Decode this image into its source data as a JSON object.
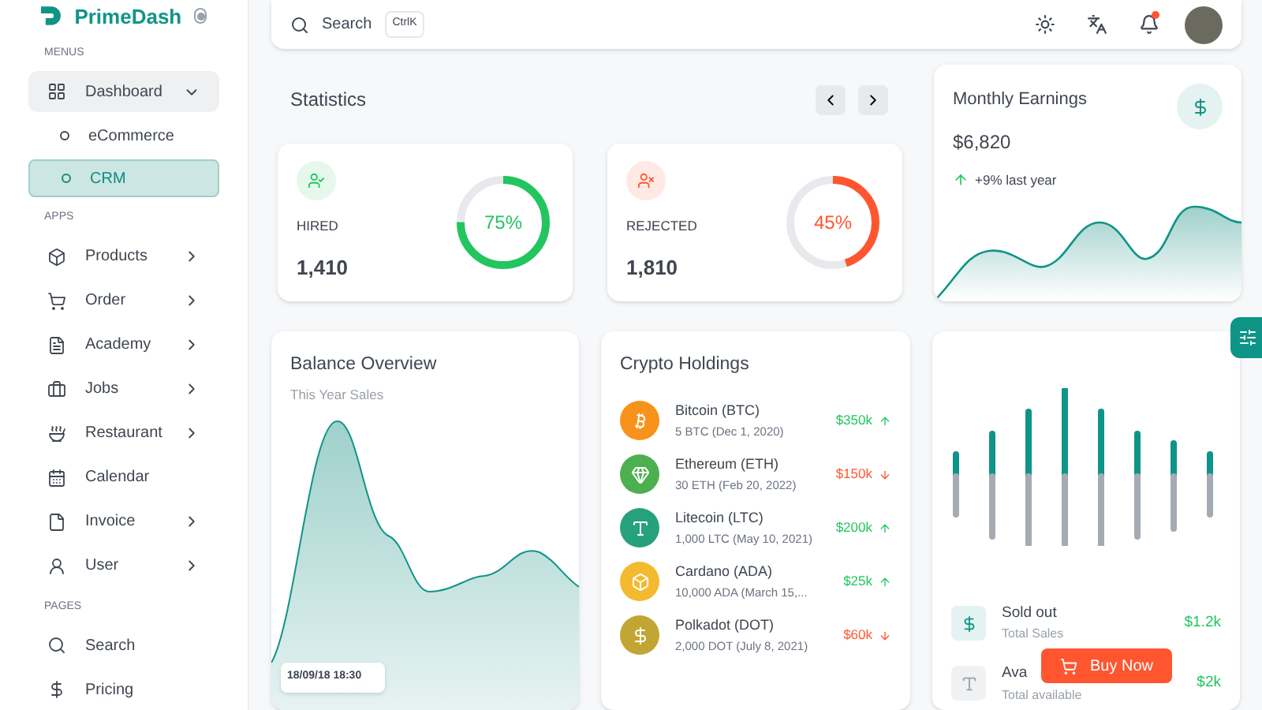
{
  "brand": {
    "name": "PrimeDash"
  },
  "sidebar": {
    "sections": [
      {
        "heading": "MENUS",
        "items": [
          {
            "label": "Dashboard",
            "kind": "group",
            "expanded": true,
            "selected": false,
            "children": [
              {
                "label": "eCommerce",
                "selected": false
              },
              {
                "label": "CRM",
                "selected": true
              }
            ]
          }
        ]
      },
      {
        "heading": "APPS",
        "items": [
          {
            "label": "Products",
            "kind": "group",
            "expanded": false,
            "selected": false
          },
          {
            "label": "Order",
            "kind": "group",
            "expanded": false,
            "selected": false
          },
          {
            "label": "Academy",
            "kind": "group",
            "expanded": false,
            "selected": false
          },
          {
            "label": "Jobs",
            "kind": "group",
            "expanded": false,
            "selected": false
          },
          {
            "label": "Restaurant",
            "kind": "group",
            "expanded": false,
            "selected": false
          },
          {
            "label": "Calendar",
            "kind": "link",
            "selected": false
          },
          {
            "label": "Invoice",
            "kind": "group",
            "expanded": false,
            "selected": false
          },
          {
            "label": "User",
            "kind": "group",
            "expanded": false,
            "selected": false
          }
        ]
      },
      {
        "heading": "PAGES",
        "items": [
          {
            "label": "Search",
            "kind": "link",
            "selected": false
          },
          {
            "label": "Pricing",
            "kind": "link",
            "selected": false
          }
        ]
      }
    ]
  },
  "header": {
    "search": {
      "placeholder": "Search",
      "shortcut": "CtrlK"
    },
    "notifications": {
      "unread": true
    }
  },
  "statistics": {
    "title": "Statistics",
    "cards": [
      {
        "label": "HIRED",
        "value": "1,410",
        "percent": "75%",
        "level": 0.75,
        "color": "#22c55e"
      },
      {
        "label": "REJECTED",
        "value": "1,810",
        "percent": "45%",
        "level": 0.45,
        "color": "#ff5630"
      }
    ]
  },
  "monthly_earnings": {
    "title": "Monthly Earnings",
    "amount": "$6,820",
    "change": "+9% last year"
  },
  "balance_overview": {
    "title": "Balance Overview",
    "subtitle": "This Year Sales",
    "tooltip": "18/09/18 18:30"
  },
  "crypto_holdings": {
    "title": "Crypto Holdings",
    "items": [
      {
        "name": "Bitcoin (BTC)",
        "detail": "5 BTC (Dec 1, 2020)",
        "value": "$350k",
        "rising": true,
        "color": "#f7931a"
      },
      {
        "name": "Ethereum (ETH)",
        "detail": "30 ETH (Feb 20, 2022)",
        "value": "$150k",
        "rising": false,
        "color": "#4caf50"
      },
      {
        "name": "Litecoin (LTC)",
        "detail": "1,000 LTC (May 10, 2021)",
        "value": "$200k",
        "rising": true,
        "color": "#26a17b"
      },
      {
        "name": "Cardano (ADA)",
        "detail": "10,000 ADA (March 15,...",
        "value": "$25k",
        "rising": true,
        "color": "#f3ba2f"
      },
      {
        "name": "Polkadot (DOT)",
        "detail": "2,000 DOT (July 8, 2021)",
        "value": "$60k",
        "rising": false,
        "color": "#c2a633"
      }
    ]
  },
  "sales": {
    "items": [
      {
        "title": "Sold out",
        "subtitle": "Total Sales",
        "value": "$1.2k"
      },
      {
        "title": "Ava",
        "subtitle": "Total available",
        "value": "$2k"
      }
    ]
  },
  "buy_button": {
    "label": "Buy Now"
  }
}
